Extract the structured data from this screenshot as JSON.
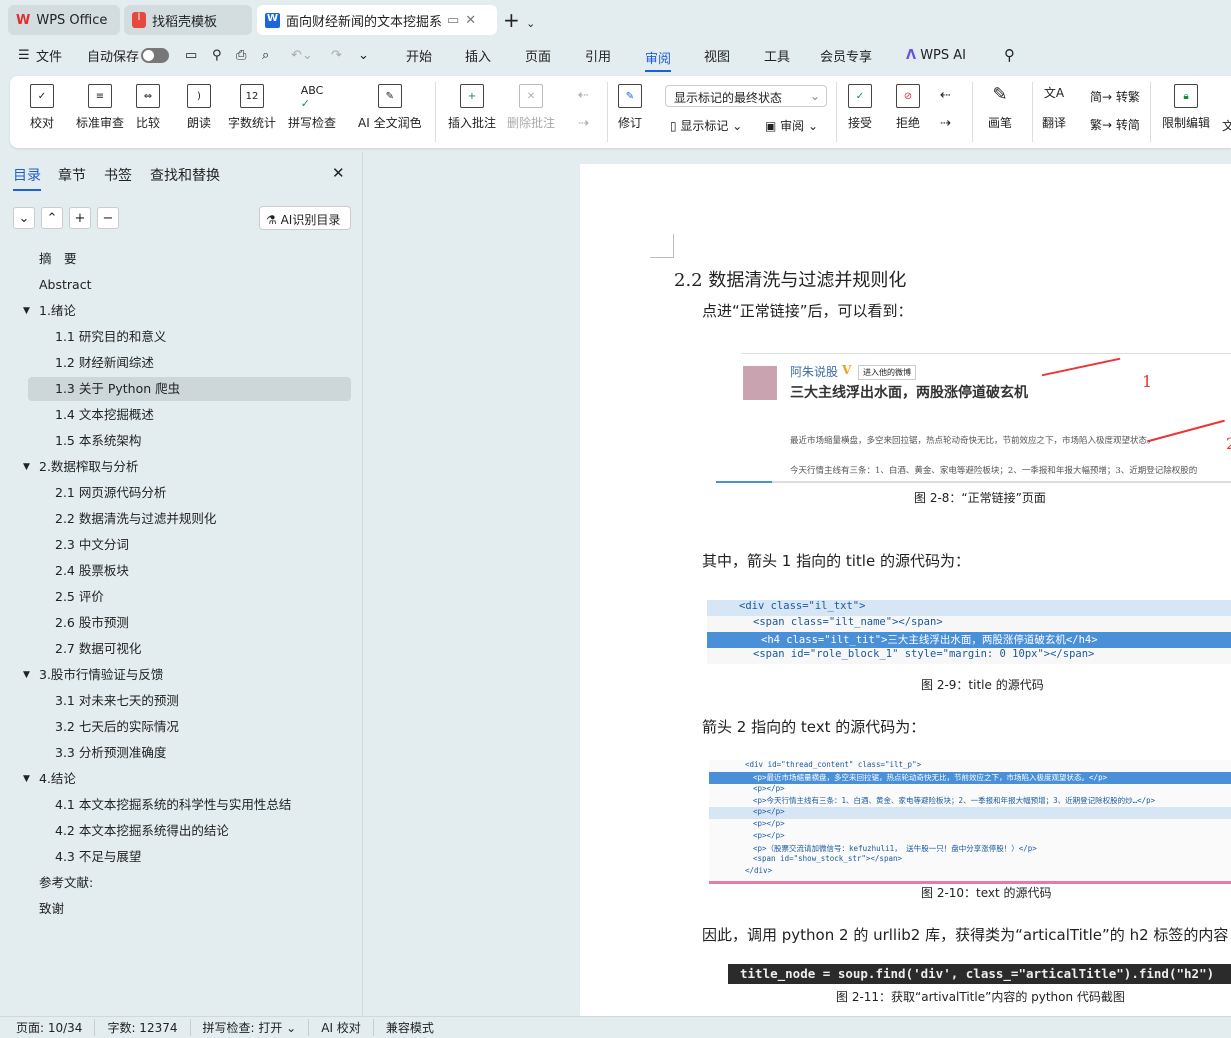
{
  "tabs": [
    {
      "label": "WPS Office"
    },
    {
      "label": "找稻壳模板"
    },
    {
      "label": "面向财经新闻的文本挖掘系统"
    }
  ],
  "menu": {
    "file": "文件",
    "autosave": "自动保存",
    "items": [
      "开始",
      "插入",
      "页面",
      "引用",
      "审阅",
      "视图",
      "工具",
      "会员专享"
    ],
    "active": "审阅",
    "wps_ai": "WPS AI"
  },
  "ribbon": {
    "proofread": "校对",
    "std_review": "标准审查",
    "compare": "比较",
    "read": "朗读",
    "word_count": "字数统计",
    "spell": "拼写检查",
    "ai_polish": "AI 全文润色",
    "insert_comment": "插入批注",
    "delete_comment": "删除批注",
    "track": "修订",
    "markup_select": "显示标记的最终状态",
    "show_markup": "显示标记",
    "review": "审阅",
    "accept": "接受",
    "reject": "拒绝",
    "pen": "画笔",
    "translate": "翻译",
    "to_trad": "转繁",
    "to_simp": "转简",
    "restrict": "限制编辑",
    "more": "文"
  },
  "panel": {
    "tabs": [
      "目录",
      "章节",
      "书签",
      "查找和替换"
    ],
    "ai_toc": "AI识别目录",
    "toc": [
      {
        "t": "摘　要",
        "l": 0
      },
      {
        "t": "Abstract",
        "l": 0
      },
      {
        "t": "1.绪论",
        "l": 0,
        "e": 1
      },
      {
        "t": "1.1  研究目的和意义",
        "l": 1
      },
      {
        "t": "1.2  财经新闻综述",
        "l": 1
      },
      {
        "t": "1.3  关于 Python 爬虫",
        "l": 1,
        "sel": 1
      },
      {
        "t": "1.4  文本挖掘概述",
        "l": 1
      },
      {
        "t": "1.5 本系统架构",
        "l": 1
      },
      {
        "t": "2.数据榨取与分析",
        "l": 0,
        "e": 1
      },
      {
        "t": "2.1  网页源代码分析",
        "l": 1
      },
      {
        "t": "2.2  数据清洗与过滤并规则化",
        "l": 1
      },
      {
        "t": "2.3  中文分词",
        "l": 1
      },
      {
        "t": "2.4  股票板块",
        "l": 1
      },
      {
        "t": "2.5  评价",
        "l": 1
      },
      {
        "t": "2.6  股市预测",
        "l": 1
      },
      {
        "t": "2.7  数据可视化",
        "l": 1
      },
      {
        "t": "3.股市行情验证与反馈",
        "l": 0,
        "e": 1
      },
      {
        "t": "3.1  对未来七天的预测",
        "l": 1
      },
      {
        "t": "3.2  七天后的实际情况",
        "l": 1
      },
      {
        "t": "3.3  分析预测准确度",
        "l": 1
      },
      {
        "t": "4.结论",
        "l": 0,
        "e": 1
      },
      {
        "t": "4.1  本文本挖掘系统的科学性与实用性总结",
        "l": 1
      },
      {
        "t": "4.2  本文本挖掘系统得出的结论",
        "l": 1
      },
      {
        "t": "4.3  不足与展望",
        "l": 1
      },
      {
        "t": "参考文献:",
        "l": 0
      },
      {
        "t": "致谢",
        "l": 0
      }
    ]
  },
  "doc": {
    "heading": "2.2  数据清洗与过滤并规则化",
    "p1": "点进“正常链接”后，可以看到：",
    "fig8": {
      "user": "阿朱说股",
      "follow": "进入他的微博",
      "title": "三大主线浮出水面，两股涨停道破玄机",
      "n1": "1",
      "n2": "2",
      "text1": "最近市场缩量横盘，多空来回拉锯，热点轮动奇快无比，节前效应之下，市场陷入极度观望状态。",
      "text2": "今天行情主线有三条：1、白酒、黄金、家电等避险板块；2、一季报和年报大幅预增；3、近期登记除权股的",
      "caption": "图 2-8：“正常链接”页面"
    },
    "p2": "其中，箭头 1 指向的 title 的源代码为：",
    "fig9": {
      "lines": [
        "<div class=\"il_txt\">",
        "<span class=\"ilt_name\"></span>",
        "<h4 class=\"ilt_tit\">三大主线浮出水面，两股涨停道破玄机</h4>",
        "<span id=\"role_block_1\" style=\"margin: 0 10px\"></span>"
      ],
      "caption": "图 2-9：title 的源代码"
    },
    "p3": "箭头 2 指向的 text 的源代码为：",
    "fig10": {
      "lines": [
        "<div id=\"thread_content\" class=\"ilt_p\">",
        "<p>最近市场缩量横盘，多空来回拉锯，热点轮动奇快无比，节前效应之下，市场陷入极度观望状态。</p>",
        "<p></p>",
        "<p>今天行情主线有三条：1、白酒、黄金、家电等避险板块；2、一季报和年报大幅预增；3、近期登记除权股的炒…</p>",
        "<p></p>",
        "<p></p>",
        "<p></p>",
        "<p>（股票交流请加微信号：kefuzhuli1， 送牛股一只！盘中分享涨停股！）</p>",
        "<span id=\"show_stock_str\"></span>",
        "</div>"
      ],
      "caption": "图 2-10：text 的源代码"
    },
    "p4": "因此，调用 python 2 的 urllib2 库，获得类为“articalTitle”的 h2 标签的内容",
    "code": "title_node = soup.find('div', class_=\"articalTitle\").find(\"h2\")",
    "fig11_caption": "图 2-11：获取“artivalTitle”内容的 python 代码截图"
  },
  "status": {
    "page": "页面: 10/34",
    "words": "字数: 12374",
    "spell": "拼写检查: 打开",
    "ai": "AI 校对",
    "compat": "兼容模式"
  },
  "colors": {
    "accent": "#1f5fd6",
    "selected_row": "#4a90d8"
  }
}
